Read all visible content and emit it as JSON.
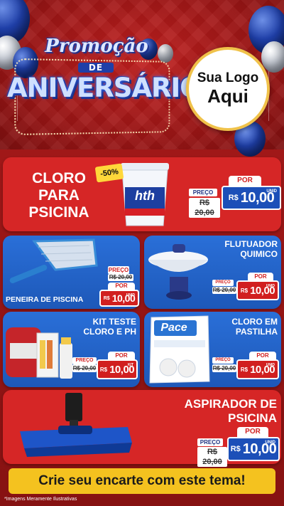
{
  "header": {
    "title_script": "Promoção",
    "title_de": "DE",
    "title_main": "ANIVERSÁRIO",
    "logo_line1": "Sua Logo",
    "logo_line2": "Aqui"
  },
  "products": {
    "cloro": {
      "title": "CLORO\nPARA\nPSICINA",
      "discount": "-50%",
      "brand": "hth",
      "preco_label": "PREÇO",
      "old_price": "R$ 20,00",
      "por_label": "POR",
      "currency": "R$",
      "price": "10,00",
      "unit": "UNID"
    },
    "peneira": {
      "title": "PENEIRA DE PISCINA",
      "preco_label": "PREÇO",
      "old_price": "R$ 20,00",
      "por_label": "POR",
      "currency": "R$",
      "price": "10,00",
      "unit": "UNID"
    },
    "flutuador": {
      "title": "FLUTUADOR\nQUIMICO",
      "preco_label": "PREÇO",
      "old_price": "R$ 20,00",
      "por_label": "POR",
      "currency": "R$",
      "price": "10,00",
      "unit": "UNID"
    },
    "kit": {
      "title": "KIT TESTE\nCLORO E PH",
      "preco_label": "PREÇO",
      "old_price": "R$ 20,00",
      "por_label": "POR",
      "currency": "R$",
      "price": "10,00",
      "unit": "KIT"
    },
    "pastilha": {
      "title": "CLORO EM\nPASTILHA",
      "brand": "Pace",
      "preco_label": "PREÇO",
      "old_price": "R$ 20,00",
      "por_label": "POR",
      "currency": "R$",
      "price": "10,00",
      "unit": "UNID"
    },
    "aspirador": {
      "title": "ASPIRADOR DE\nPSICINA",
      "preco_label": "PREÇO",
      "old_price": "R$ 20,00",
      "por_label": "POR",
      "currency": "R$",
      "price": "10,00",
      "unit": "UNID"
    }
  },
  "footer": {
    "cta": "Crie seu encarte com este tema!",
    "note": "*Imagens Meramente Ilustrativas"
  },
  "colors": {
    "red": "#d62626",
    "blue": "#1d58b8",
    "yellow": "#f4c21f"
  }
}
